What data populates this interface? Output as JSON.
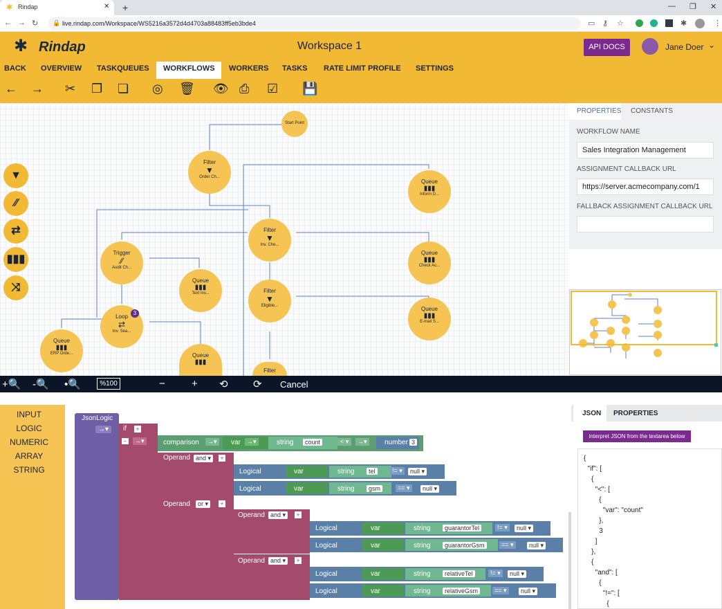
{
  "browser": {
    "tab_title": "Rindap",
    "url": "live.rindap.com/Workspace/WS5216a3572d4d4703a88483ff5eb3bde4"
  },
  "header": {
    "logo": "Rindap",
    "title": "Workspace 1",
    "api_docs": "API DOCS",
    "user": "Jane Doer"
  },
  "nav": [
    "BACK",
    "OVERVIEW",
    "TASKQUEUES",
    "WORKFLOWS",
    "WORKERS",
    "TASKS",
    "RATE LIMIT PROFILE",
    "SETTINGS"
  ],
  "nav_active": "WORKFLOWS",
  "nodes": {
    "start": "Start Point",
    "n1": {
      "type": "Filter",
      "sub": "Order Ch..."
    },
    "n2": {
      "type": "Queue",
      "sub": "Inform D..."
    },
    "n3": {
      "type": "Filter",
      "sub": "Inv. Che..."
    },
    "n4": {
      "type": "Trigger",
      "sub": "Audit Ch..."
    },
    "n5": {
      "type": "Queue",
      "sub": "Check Ac..."
    },
    "n6": {
      "type": "Queue",
      "sub": "Text Inv..."
    },
    "n7": {
      "type": "Filter",
      "sub": "Eligible..."
    },
    "n8": {
      "type": "Loop",
      "sub": "Inv. Sea...",
      "badge": "3"
    },
    "n9": {
      "type": "Queue",
      "sub": "E-mail S..."
    },
    "n10": {
      "type": "Queue",
      "sub": "ERP Orde..."
    },
    "n11": {
      "type": "Queue",
      "sub": ""
    },
    "n12": {
      "type": "Filter",
      "sub": ""
    }
  },
  "panel": {
    "tabs": [
      "PROPERTIES",
      "CONSTANTS"
    ],
    "workflow_name_label": "WORKFLOW NAME",
    "workflow_name": "Sales Integration Management",
    "assign_label": "ASSIGNMENT CALLBACK URL",
    "assign_url": "https://server.acmecompany.com/1",
    "fallback_label": "FALLBACK ASSIGNMENT CALLBACK URL",
    "fallback_url": ""
  },
  "zoombar": {
    "zoom": "%100",
    "cancel": "Cancel"
  },
  "categories": [
    "INPUT",
    "LOGIC",
    "NUMERIC",
    "ARRAY",
    "STRING"
  ],
  "blocks": {
    "root": "JsonLogic",
    "if": "if",
    "comparison": "comparison",
    "var": "var",
    "string": "string",
    "number": "number",
    "count": "count",
    "lt": "<",
    "three": "3",
    "operand": "Operand",
    "and": "and",
    "or": "or",
    "logical": "Logical",
    "tel": "tel",
    "gsm": "gsm",
    "neq": "!=",
    "eq": "==",
    "null": "null",
    "guarantorTel": "guarantorTel",
    "guarantorGsm": "guarantorGsm",
    "relativeTel": "relativeTel",
    "relativeGsm": "relativeGsm"
  },
  "json_panel": {
    "tabs": [
      "JSON",
      "PROPERTIES"
    ],
    "interpret": "interpret JSON from the textarea below",
    "text": "{\n  \"if\": [\n    {\n      \"<\": [\n        {\n          \"var\": \"count\"\n        },\n        3\n      ]\n    },\n    {\n      \"and\": [\n        {\n          \"!=\": [\n            {"
  },
  "colors": {
    "brand": "#f2b935",
    "purple": "#7b2a8f",
    "dark": "#0a1628"
  }
}
